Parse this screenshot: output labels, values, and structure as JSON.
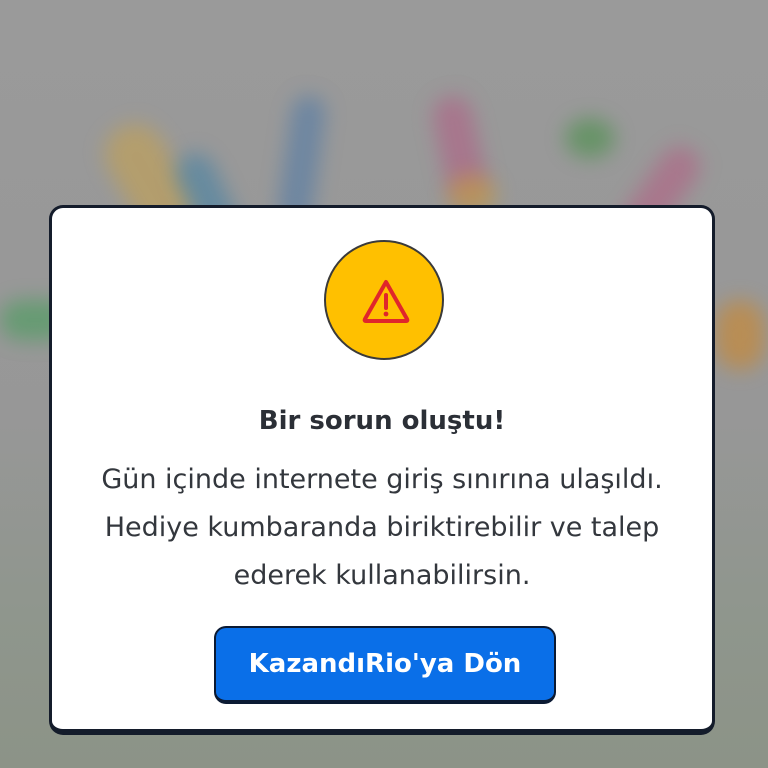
{
  "modal": {
    "icon": "warning-triangle-icon",
    "title": "Bir sorun oluştu!",
    "message": "Gün içinde internete giriş sınırına ulaşıldı. Hediye kumbaranda biriktirebilir ve talep ederek kullanabilirsin.",
    "button_label": "KazandıRio'ya Dön"
  },
  "colors": {
    "accent_button": "#0a6fe8",
    "warning_circle": "#ffc000",
    "warning_icon": "#e0262b",
    "overlay": "#999999"
  }
}
